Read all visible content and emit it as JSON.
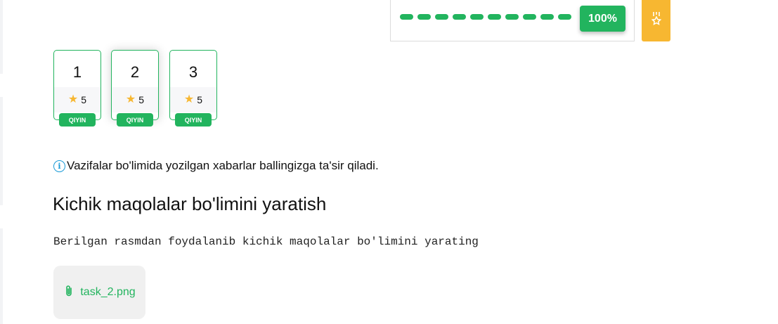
{
  "progress": {
    "percent_label": "100%",
    "value": 1.0,
    "segments": 10,
    "color": "#22b45e"
  },
  "medal_button": {
    "icon": "medal-icon",
    "color": "#f7b731"
  },
  "task_cards": [
    {
      "number": "1",
      "stars": "5",
      "level": "QIYIN"
    },
    {
      "number": "2",
      "stars": "5",
      "level": "QIYIN",
      "selected": true
    },
    {
      "number": "3",
      "stars": "5",
      "level": "QIYIN"
    }
  ],
  "info": {
    "icon": "info-icon",
    "text": "Vazifalar bo'limida yozilgan xabarlar ballingizga ta'sir qiladi."
  },
  "task": {
    "title": "Kichik maqolalar bo'limini yaratish",
    "description": "Berilgan rasmdan foydalanib kichik maqolalar bo'limini yarating",
    "attachment": {
      "icon": "paperclip-icon",
      "filename": "task_2.png"
    }
  },
  "colors": {
    "accent": "#22b45e",
    "star": "#f7b731",
    "info": "#1a9bd7"
  }
}
